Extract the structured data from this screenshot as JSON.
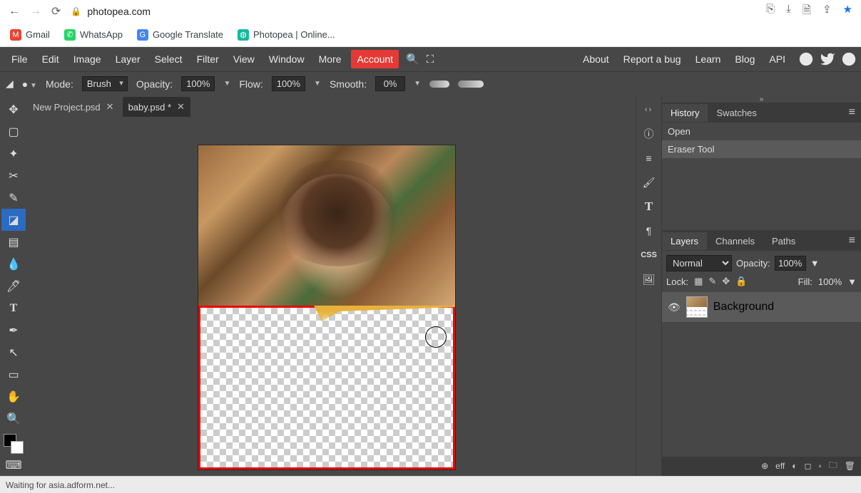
{
  "browser": {
    "url": "photopea.com",
    "bookmarks": [
      {
        "label": "Gmail",
        "icon_class": "gm",
        "glyph": "M"
      },
      {
        "label": "WhatsApp",
        "icon_class": "wa",
        "glyph": "✆"
      },
      {
        "label": "Google Translate",
        "icon_class": "gt",
        "glyph": "G"
      },
      {
        "label": "Photopea | Online...",
        "icon_class": "pp",
        "glyph": "◍"
      }
    ]
  },
  "menus": [
    "File",
    "Edit",
    "Image",
    "Layer",
    "Select",
    "Filter",
    "View",
    "Window",
    "More"
  ],
  "account_label": "Account",
  "right_links": [
    "About",
    "Report a bug",
    "Learn",
    "Blog",
    "API"
  ],
  "options": {
    "mode_label": "Mode:",
    "mode_value": "Brush",
    "opacity_label": "Opacity:",
    "opacity_value": "100%",
    "flow_label": "Flow:",
    "flow_value": "100%",
    "smooth_label": "Smooth:",
    "smooth_value": "0%"
  },
  "tabs": [
    {
      "title": "New Project.psd",
      "active": false
    },
    {
      "title": "baby.psd *",
      "active": true
    }
  ],
  "dock_strip": {
    "css_label": "CSS"
  },
  "history_panel": {
    "tabs": [
      "History",
      "Swatches"
    ],
    "items": [
      "Open",
      "Eraser Tool"
    ],
    "selected_index": 1
  },
  "layers_panel": {
    "tabs": [
      "Layers",
      "Channels",
      "Paths"
    ],
    "blend_mode": "Normal",
    "opacity_label": "Opacity:",
    "opacity_value": "100%",
    "lock_label": "Lock:",
    "fill_label": "Fill:",
    "fill_value": "100%",
    "layer_name": "Background",
    "footer_icons": [
      "⊕",
      "eff",
      "◐",
      "◻",
      "▫",
      "🗀",
      "🗑"
    ]
  },
  "status_text": "Waiting for asia.adform.net..."
}
